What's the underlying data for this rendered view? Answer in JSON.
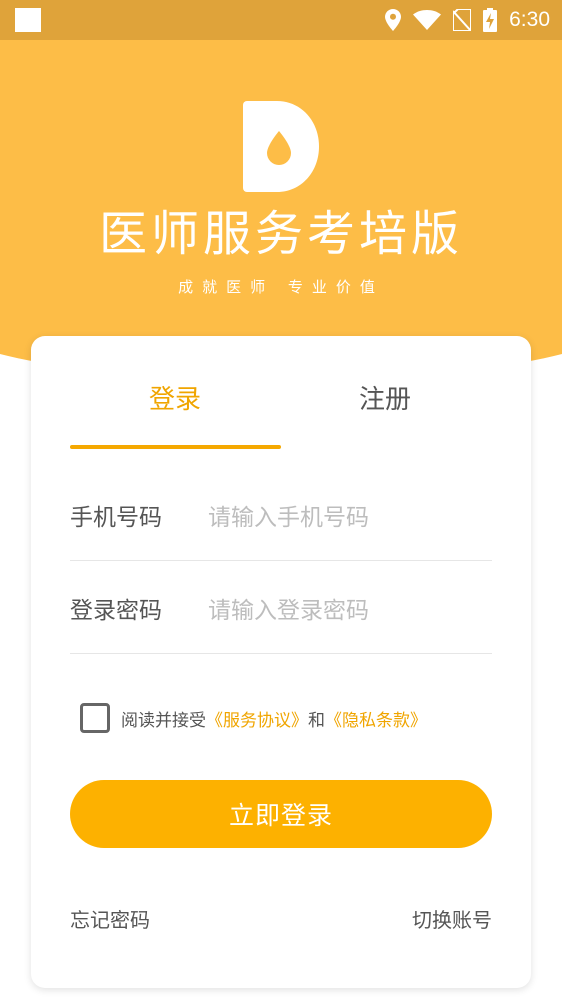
{
  "status_bar": {
    "time": "6:30",
    "icons": [
      "notification-square-icon",
      "location-icon",
      "wifi-icon",
      "no-sim-icon",
      "battery-charging-icon"
    ]
  },
  "header": {
    "logo_icon": "drop-logo-icon",
    "title": "医师服务考培版",
    "slogan": "成就医师 专业价值"
  },
  "tabs": [
    {
      "label": "登录",
      "active": true
    },
    {
      "label": "注册",
      "active": false
    }
  ],
  "form": {
    "phone": {
      "label": "手机号码",
      "placeholder": "请输入手机号码",
      "value": ""
    },
    "password": {
      "label": "登录密码",
      "placeholder": "请输入登录密码",
      "value": ""
    }
  },
  "agreement": {
    "checked": false,
    "prefix": "阅读并接受",
    "service_link": "《服务协议》",
    "conjunction": "和",
    "privacy_link": "《隐私条款》"
  },
  "login_button": "立即登录",
  "links": {
    "forgot": "忘记密码",
    "switch": "切换账号"
  },
  "colors": {
    "accent": "#fdb100",
    "header": "#fdbd47",
    "status_bar": "#dfa33a",
    "active_tab": "#f0a500"
  }
}
